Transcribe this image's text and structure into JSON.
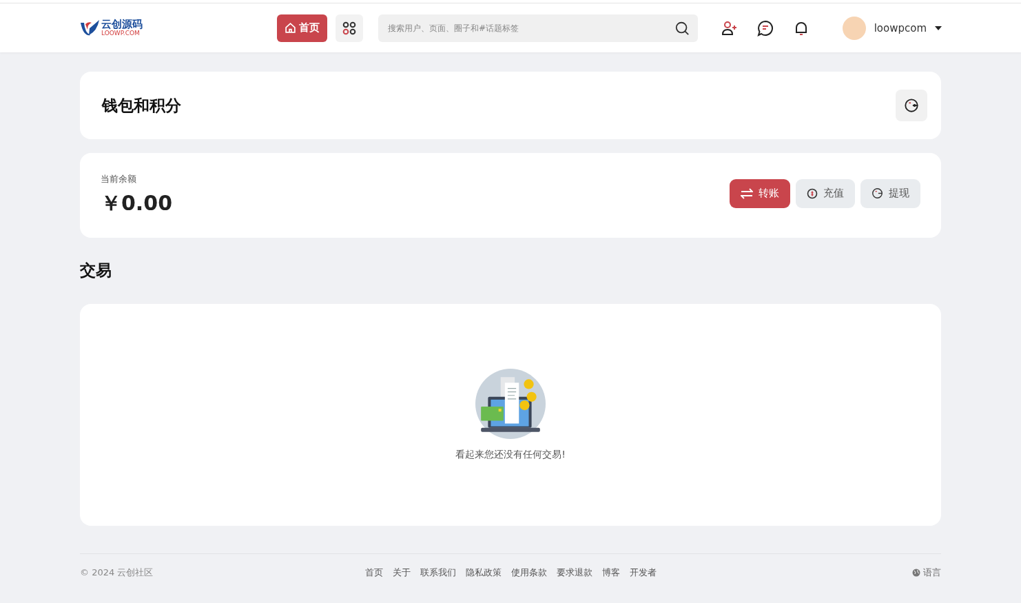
{
  "header": {
    "logo": {
      "title": "云创源码",
      "subtitle": "LOOWP.COM"
    },
    "nav": [
      {
        "label": "首页",
        "selected": true
      },
      {
        "selected": false
      }
    ],
    "search": {
      "placeholder": "搜索用户、页面、圈子和#话题标签"
    },
    "user": {
      "name": "loowpcom"
    }
  },
  "page_title": "钱包和积分",
  "balance": {
    "label": "当前余额",
    "amount": "￥0.00",
    "actions": [
      {
        "label": "转账",
        "kind": "transfer",
        "primary": true
      },
      {
        "label": "充值",
        "kind": "deposit",
        "primary": false
      },
      {
        "label": "提现",
        "kind": "withdraw",
        "primary": false
      }
    ]
  },
  "transactions": {
    "title": "交易",
    "empty_text": "看起来您还没有任何交易!"
  },
  "footer": {
    "copyright": "© 2024 云创社区",
    "links": [
      "首页",
      "关于",
      "联系我们",
      "隐私政策",
      "使用条款",
      "要求退款",
      "博客",
      "开发者"
    ],
    "language": "语言"
  }
}
